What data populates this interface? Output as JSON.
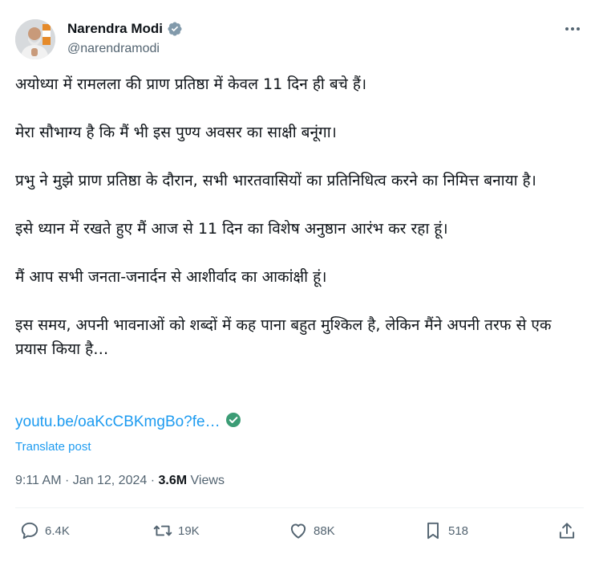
{
  "author": {
    "name": "Narendra Modi",
    "handle": "@narendramodi",
    "verified_color": "#829aab"
  },
  "tweet": {
    "paragraphs": [
      "अयोध्या में रामलला की प्राण प्रतिष्ठा में केवल 11 दिन ही बचे हैं।",
      "मेरा सौभाग्य है कि मैं भी इस पुण्य अवसर का साक्षी बनूंगा।",
      "प्रभु ने मुझे प्राण प्रतिष्ठा के दौरान, सभी भारतवासियों का प्रतिनिधित्व करने का निमित्त बनाया है।",
      "इसे ध्यान में रखते हुए मैं आज से 11 दिन का विशेष अनुष्ठान आरंभ कर रहा हूं।",
      "मैं आप सभी जनता-जनार्दन से आशीर्वाद का आकांक्षी हूं।",
      "इस समय, अपनी भावनाओं को शब्दों में कह पाना बहुत मुश्किल है, लेकिन मैंने अपनी तरफ से एक प्रयास किया है…"
    ],
    "link": "youtu.be/oaKcCBKmgBo?fe…",
    "translate": "Translate post",
    "time": "9:11 AM",
    "date": "Jan 12, 2024",
    "views_count": "3.6M",
    "views_label": "Views"
  },
  "actions": {
    "replies": "6.4K",
    "reposts": "19K",
    "likes": "88K",
    "bookmarks": "518"
  },
  "colors": {
    "accent": "#1d9bf0",
    "muted": "#536471",
    "check": "#3b9c75"
  }
}
